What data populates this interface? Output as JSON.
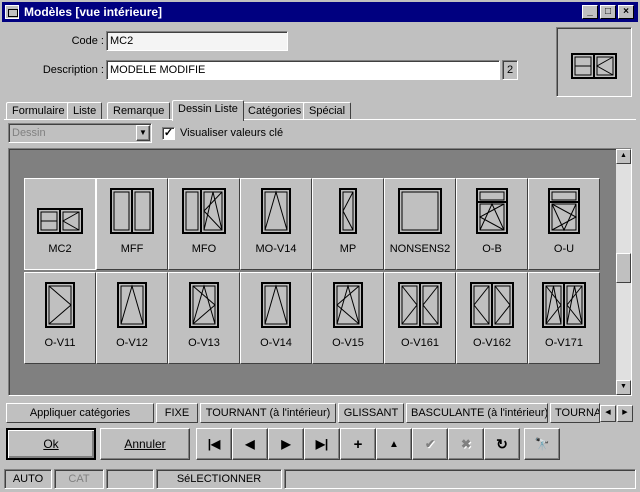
{
  "window": {
    "title": "Modèles [vue intérieure]"
  },
  "form": {
    "code_label": "Code :",
    "code_value": "MC2",
    "description_label": "Description :",
    "description_value": "MODELE MODIFIE",
    "description_count": "2"
  },
  "tabs": [
    {
      "label": "Formulaire"
    },
    {
      "label": "Liste"
    },
    {
      "label": "Remarque"
    },
    {
      "label": "Dessin Liste",
      "active": true
    },
    {
      "label": "Catégories"
    },
    {
      "label": "Spécial"
    }
  ],
  "toolbar": {
    "view_select": "Dessin",
    "show_key_values_label": "Visualiser valeurs clé",
    "show_key_values_checked": true
  },
  "models": [
    {
      "name": "MC2",
      "icon": "mc2-combo-icon",
      "selected": true
    },
    {
      "name": "MFF",
      "icon": "double-fixed-icon"
    },
    {
      "name": "MFO",
      "icon": "fixed-plus-opening-icon"
    },
    {
      "name": "MO-V14",
      "icon": "tilt-single-icon"
    },
    {
      "name": "MP",
      "icon": "narrow-swing-icon"
    },
    {
      "name": "NONSENS2",
      "icon": "plain-fixed-icon"
    },
    {
      "name": "O-B",
      "icon": "bottom-hung-transom-icon"
    },
    {
      "name": "O-U",
      "icon": "top-hung-transom-icon"
    },
    {
      "name": "O-V11",
      "icon": "swing-left-icon"
    },
    {
      "name": "O-V12",
      "icon": "tilt-up-icon"
    },
    {
      "name": "O-V13",
      "icon": "tilt-turn-icon"
    },
    {
      "name": "O-V14",
      "icon": "tilt-single-icon"
    },
    {
      "name": "O-V15",
      "icon": "tilt-turn-alt-icon"
    },
    {
      "name": "O-V161",
      "icon": "double-swing-icon"
    },
    {
      "name": "O-V162",
      "icon": "double-swing-alt-icon"
    },
    {
      "name": "O-V171",
      "icon": "double-tilt-turn-icon"
    }
  ],
  "categories": {
    "apply_label": "Appliquer catégories",
    "items": [
      "FIXE",
      "TOURNANT (à l'intérieur)",
      "GLISSANT",
      "BASCULANTE (à l'intérieur)",
      "TOURNANT"
    ]
  },
  "actions": {
    "ok_label": "Ok",
    "cancel_label": "Annuler",
    "first_glyph": "|◀",
    "prev_glyph": "◀",
    "next_glyph": "▶",
    "last_glyph": "▶|",
    "add_glyph": "+",
    "up_glyph": "▲",
    "confirm_glyph": "✔",
    "delete_glyph": "✖",
    "refresh_glyph": "↻",
    "find_glyph": "🔭"
  },
  "status": {
    "mode": "AUTO",
    "cat": "CAT",
    "empty": "",
    "action": "SéLECTIONNER"
  }
}
